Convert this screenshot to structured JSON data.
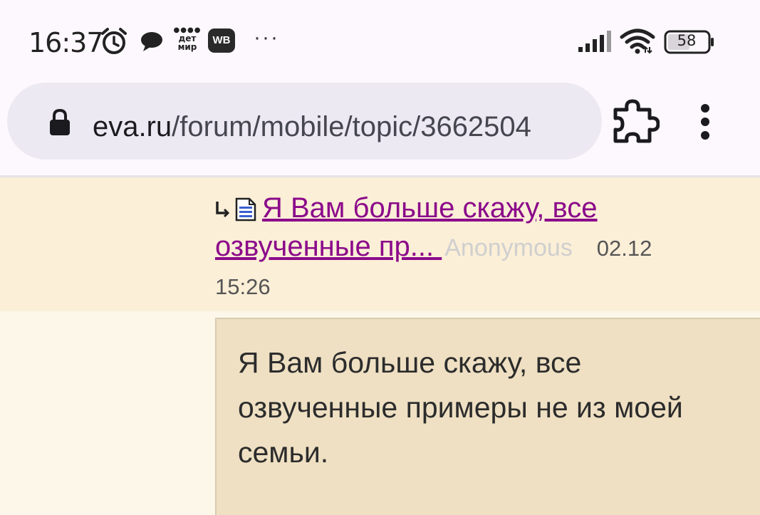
{
  "status_bar": {
    "time": "16:37",
    "icons": [
      "alarm-icon",
      "chat-bubble-icon",
      "detmir-app-icon",
      "wb-app-icon",
      "more-notifications-icon",
      "signal-icon",
      "wifi-icon",
      "battery-icon"
    ],
    "detmir_label_line1": "дет",
    "detmir_label_line2": "мир",
    "wb_label": "WB",
    "more_label": "···",
    "battery_level": "58"
  },
  "browser": {
    "url_domain": "eva.ru",
    "url_path": "/forum/mobile/topic/3662504",
    "extension_icon": "puzzle-icon",
    "menu_icon": "three-dots-vertical-icon"
  },
  "reply": {
    "link_text": "Я Вам больше скажу, все озвученные пр... ",
    "author": "Anonymous",
    "date": "02.12",
    "time": "15:26"
  },
  "message": {
    "text": "Я Вам больше скажу, все озвученные примеры не из моей семьи."
  },
  "colors": {
    "reply_background": "#fbefd7",
    "message_background": "#efe0c3",
    "page_background": "#fdf7ea",
    "link_color": "#8b0a8a",
    "url_pill": "#ece9f3"
  }
}
